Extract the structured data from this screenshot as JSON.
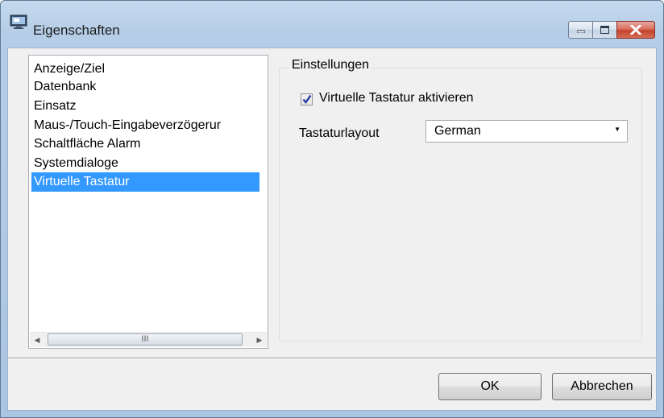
{
  "window": {
    "title": "Eigenschaften",
    "icon": "monitor-app-icon"
  },
  "caption_buttons": [
    "minimize-icon",
    "maximize-icon",
    "close-icon"
  ],
  "list": {
    "items": [
      "Anzeige/Ziel",
      "Datenbank",
      "Einsatz",
      "Maus-/Touch-Eingabeverzögerur",
      "Schaltfläche Alarm",
      "Systemdialoge",
      "Virtuelle Tastatur"
    ],
    "selected": "Virtuelle Tastatur",
    "scroll_grip": "III"
  },
  "settings": {
    "group_title": "Einstellungen",
    "checkbox_label": "Virtuelle Tastatur aktivieren",
    "checkbox_checked": true,
    "layout_label": "Tastaturlayout",
    "layout_value": "German"
  },
  "buttons": {
    "ok": "OK",
    "cancel": "Abbrechen"
  },
  "colors": {
    "selection": "#3399ff",
    "close_button": "#c4432d",
    "frame": "#aac5e2"
  }
}
